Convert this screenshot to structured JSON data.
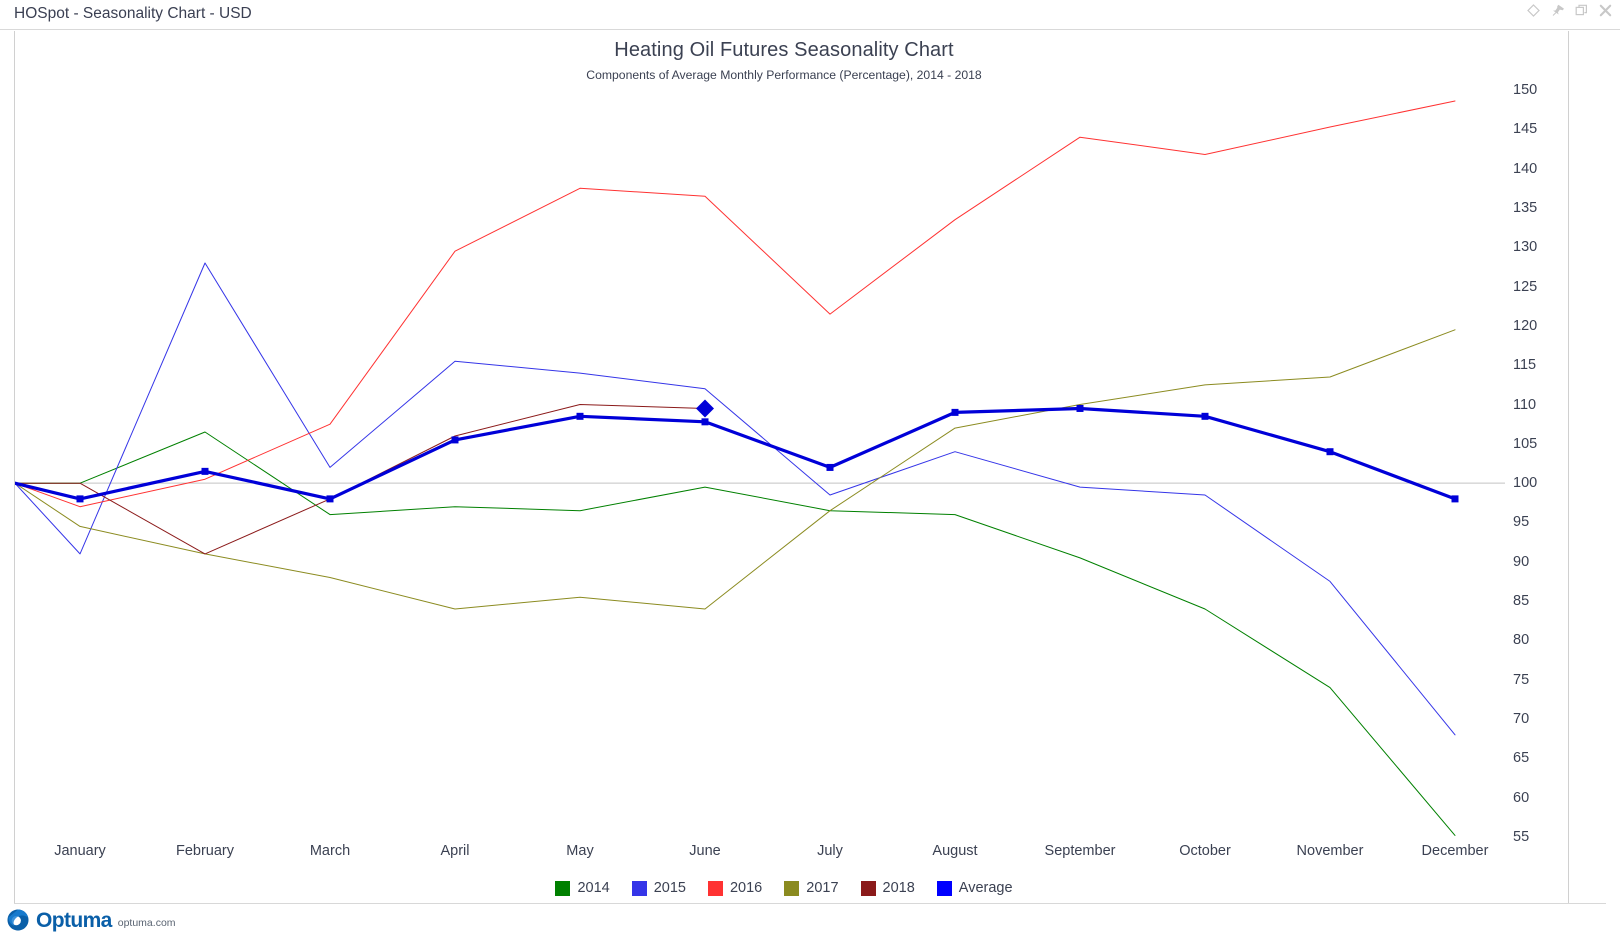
{
  "window": {
    "title": "HOSpot - Seasonality Chart - USD",
    "buttons": [
      {
        "name": "diamond-icon",
        "label": "Diamond"
      },
      {
        "name": "pin-icon",
        "label": "Pin"
      },
      {
        "name": "restore-icon",
        "label": "Restore"
      },
      {
        "name": "close-icon",
        "label": "Close"
      }
    ]
  },
  "footer": {
    "logo_word": "Optuma",
    "logo_domain": "optuma.com"
  },
  "chart_data": {
    "type": "line",
    "title": "Heating Oil Futures Seasonality Chart",
    "subtitle": "Components of Average Monthly Performance (Percentage), 2014 - 2018",
    "xlabel": "",
    "ylabel": "",
    "grid": false,
    "baseline": 100,
    "legend_position": "bottom",
    "ylim": [
      55,
      150
    ],
    "yticks": [
      150,
      145,
      140,
      135,
      130,
      125,
      120,
      115,
      110,
      105,
      100,
      95,
      90,
      85,
      80,
      75,
      70,
      65,
      60,
      55
    ],
    "categories": [
      "January",
      "February",
      "March",
      "April",
      "May",
      "June",
      "July",
      "August",
      "September",
      "October",
      "November",
      "December"
    ],
    "series": [
      {
        "name": "2014",
        "color": "#008000",
        "width": 1,
        "values": [
          100,
          106.5,
          96,
          97,
          96.5,
          99.5,
          96.5,
          96,
          90.5,
          84,
          74,
          55.2
        ]
      },
      {
        "name": "2015",
        "color": "#3535e8",
        "width": 1,
        "values": [
          91,
          128,
          102,
          115.5,
          114,
          112,
          98.5,
          104,
          99.5,
          98.5,
          87.5,
          68
        ]
      },
      {
        "name": "2016",
        "color": "#ff3232",
        "width": 1,
        "values": [
          97,
          100.5,
          107.5,
          129.5,
          137.5,
          136.5,
          121.5,
          133.5,
          144,
          141.8,
          145.3,
          148.6
        ]
      },
      {
        "name": "2017",
        "color": "#8b8b20",
        "width": 1,
        "values": [
          94.5,
          91,
          88,
          84,
          85.5,
          84,
          96.5,
          107,
          110,
          112.5,
          113.5,
          119.5
        ]
      },
      {
        "name": "2018",
        "color": "#8b1a1a",
        "width": 1,
        "values": [
          100,
          91,
          98,
          106,
          110,
          109.5,
          null,
          null,
          null,
          null,
          null,
          null
        ]
      },
      {
        "name": "Average",
        "color": "#0000d8",
        "width": 3.2,
        "markers": true,
        "values": [
          98,
          101.5,
          98,
          105.5,
          108.5,
          107.8,
          102,
          109,
          109.5,
          108.5,
          104,
          98
        ]
      }
    ],
    "origin_value": 100,
    "cursor_marker": {
      "series": "2018",
      "category": "June",
      "value": 109.5,
      "shape": "diamond",
      "color": "#0000d8"
    }
  }
}
